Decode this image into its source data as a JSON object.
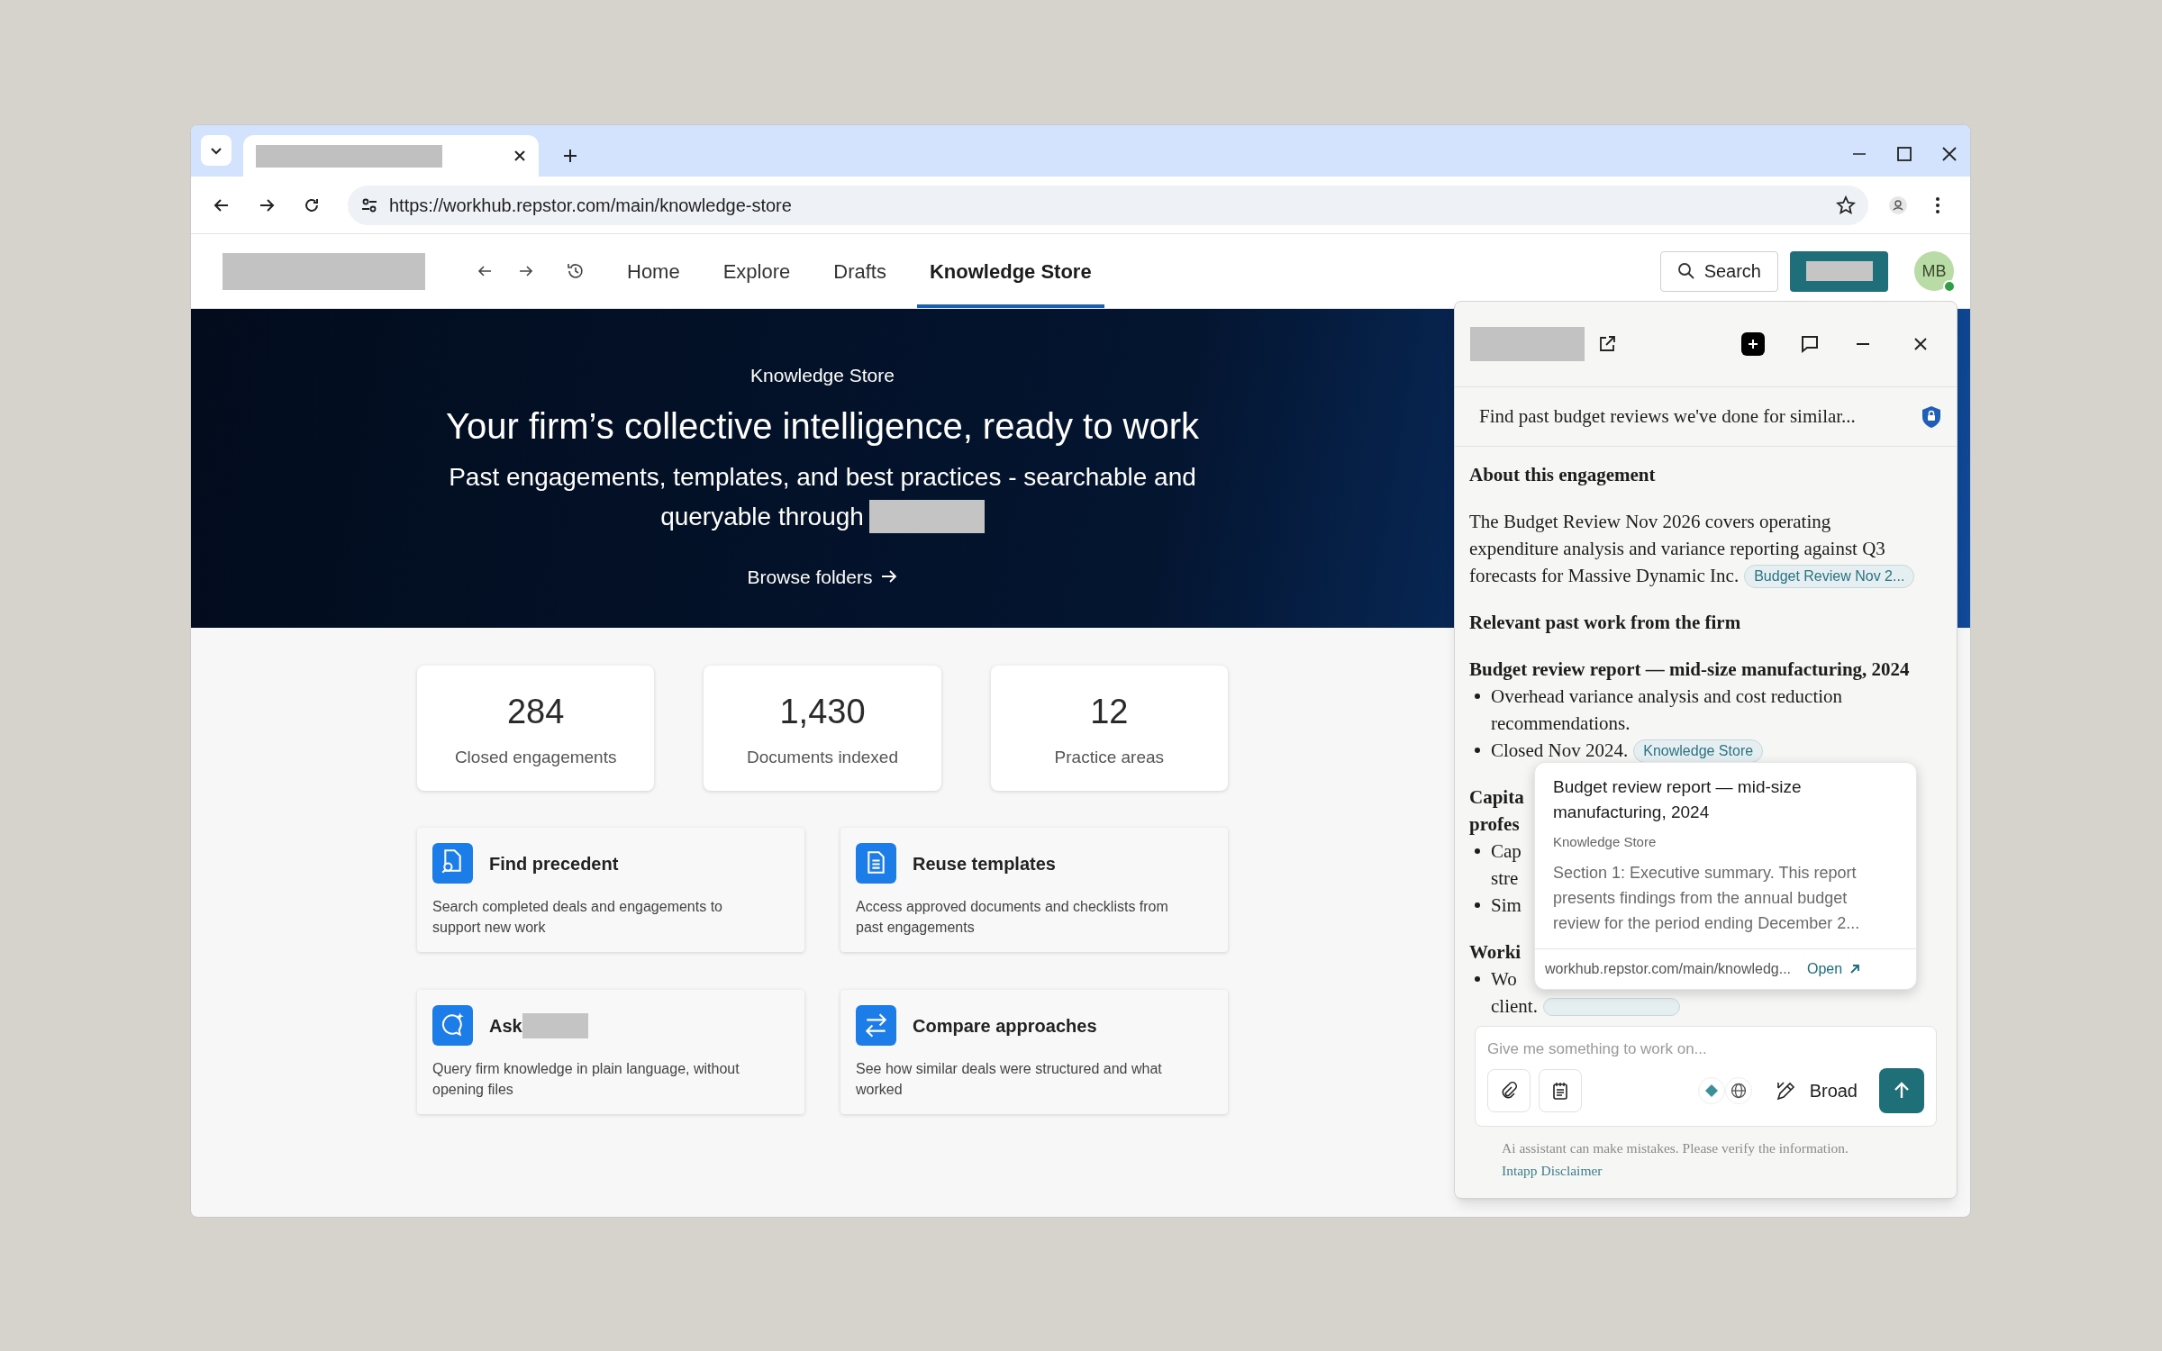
{
  "browser": {
    "url": "https://workhub.repstor.com/main/knowledge-store"
  },
  "nav": {
    "tabs": [
      {
        "label": "Home",
        "selected": false
      },
      {
        "label": "Explore",
        "selected": false
      },
      {
        "label": "Drafts",
        "selected": false
      },
      {
        "label": "Knowledge Store",
        "selected": true
      }
    ],
    "search": "Search",
    "avatar": "MB"
  },
  "hero": {
    "eyebrow": "Knowledge Store",
    "title": "Your firm’s collective intelligence, ready to work",
    "subtitle_1": "Past engagements, templates, and best practices - searchable and",
    "subtitle_2": "queryable through",
    "link": "Browse folders"
  },
  "stats": [
    {
      "value": "284",
      "label": "Closed engagements"
    },
    {
      "value": "1,430",
      "label": "Documents indexed"
    },
    {
      "value": "12",
      "label": "Practice areas"
    }
  ],
  "actions": [
    {
      "kind": "find",
      "title": "Find precedent",
      "title_redacted": false,
      "description": "Search completed deals and engagements to support new work"
    },
    {
      "kind": "templates",
      "title": "Reuse templates",
      "title_redacted": false,
      "description": "Access approved documents and checklists from past engagements"
    },
    {
      "kind": "ask",
      "title": "Ask",
      "title_redacted": true,
      "description": "Query firm knowledge in plain language, without opening files"
    },
    {
      "kind": "compare",
      "title": "Compare approaches",
      "title_redacted": false,
      "description": "See how similar deals were structured and what worked"
    }
  ],
  "assistant": {
    "query": "Find past budget reviews we've done for similar...",
    "blocks": [
      {
        "kind": "heading",
        "lines": [
          "About this engagement"
        ]
      },
      {
        "kind": "paragraph",
        "lines": [
          "The Budget Review Nov 2026 covers operating",
          "expenditure analysis and variance reporting against Q3",
          "forecasts for Massive Dynamic Inc."
        ],
        "badge": "Budget Review Nov 2..."
      },
      {
        "kind": "heading",
        "lines": [
          "Relevant past work from the firm"
        ]
      },
      {
        "kind": "subheading",
        "lines": [
          "Budget review report — mid-size manufacturing, 2024"
        ]
      },
      {
        "kind": "bullet",
        "lines": [
          "Overhead variance analysis and cost reduction",
          "recommendations."
        ]
      },
      {
        "kind": "bullet",
        "lines": [
          "Closed Nov 2024."
        ],
        "badge": "Knowledge Store"
      },
      {
        "kind": "heading",
        "lines": [
          "Capita",
          "profes"
        ]
      },
      {
        "kind": "bullet",
        "lines": [
          "Cap",
          "stre"
        ]
      },
      {
        "kind": "bullet",
        "lines": [
          "Sim"
        ]
      },
      {
        "kind": "heading",
        "lines": [
          "Worki"
        ]
      },
      {
        "kind": "bullet",
        "lines": [
          "Wo",
          "client."
        ],
        "badge_covered": true
      }
    ],
    "popover": {
      "title": "Budget review report — mid-size manufacturing, 2024",
      "source": "Knowledge Store",
      "excerpt": "Section 1: Executive summary. This report presents findings from the annual budget review for the period ending December 2...",
      "url": "workhub.repstor.com/main/knowledg...",
      "open": "Open"
    },
    "composer": {
      "placeholder": "Give me something to work on...",
      "mode": "Broad"
    },
    "disclaimer": "Ai assistant can make mistakes. Please verify the information.",
    "disclaimer_link": "Intapp Disclaimer"
  }
}
